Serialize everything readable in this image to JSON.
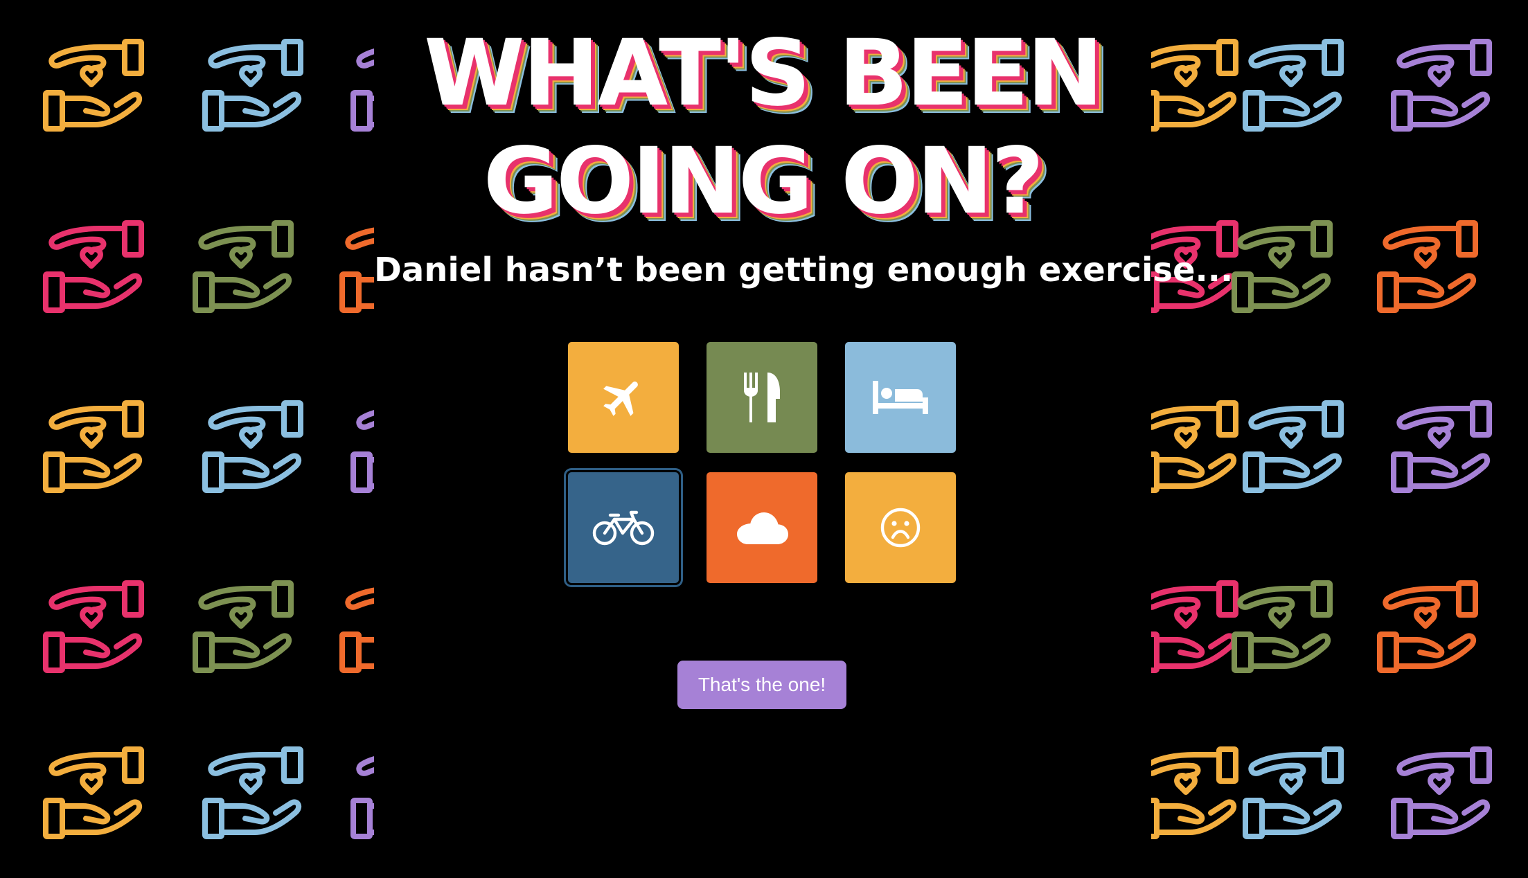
{
  "title": {
    "line1": "WHAT'S BEEN",
    "line2": "GOING ON?"
  },
  "subtitle": "Daniel hasn’t been getting enough exercise...",
  "options": [
    {
      "icon": "airplane-icon",
      "color": "#f3ae3e",
      "selected": false
    },
    {
      "icon": "fork-knife-icon",
      "color": "#768a52",
      "selected": false
    },
    {
      "icon": "bed-icon",
      "color": "#8bbbdb",
      "selected": false
    },
    {
      "icon": "bicycle-icon",
      "color": "#36648a",
      "selected": true
    },
    {
      "icon": "cloud-icon",
      "color": "#ef6a2c",
      "selected": false
    },
    {
      "icon": "sad-face-icon",
      "color": "#f3ae3e",
      "selected": false
    }
  ],
  "submit_label": "That's the one!",
  "colors": {
    "background": "#000000",
    "accent_button": "#a681d6",
    "pattern": [
      "#f3ae3e",
      "#8bbfe0",
      "#a681d6",
      "#e8326c",
      "#7d9152",
      "#ef6a2c"
    ]
  }
}
